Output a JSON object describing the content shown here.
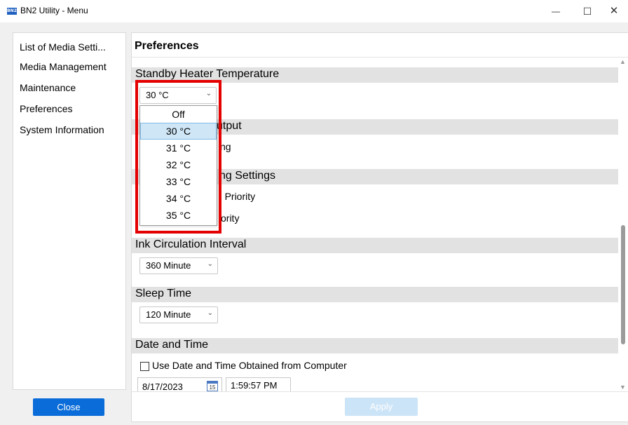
{
  "window": {
    "title": "BN2 Utility - Menu",
    "app_icon_text": "BN2",
    "minimize": "—",
    "maximize": "☐",
    "close": "✕"
  },
  "sidebar": {
    "items": [
      {
        "label": "List of Media Setti..."
      },
      {
        "label": "Media Management"
      },
      {
        "label": "Maintenance"
      },
      {
        "label": "Preferences"
      },
      {
        "label": "System Information"
      }
    ]
  },
  "close_button": "Close",
  "apply_button": "Apply",
  "main": {
    "title": "Preferences",
    "sections": {
      "standby_heater": {
        "heading": "Standby Heater Temperature",
        "selected": "30 °C"
      },
      "output": {
        "heading_fragment": "utput",
        "option_fragment": "ng"
      },
      "print_settings": {
        "heading_fragment": "ng Settings",
        "option1_fragment": "' Priority",
        "option2_fragment": "ority"
      },
      "ink_circulation": {
        "heading": "Ink Circulation Interval",
        "value": "360 Minute"
      },
      "sleep_time": {
        "heading": "Sleep Time",
        "value": "120 Minute"
      },
      "date_time": {
        "heading": "Date and Time",
        "checkbox_label": "Use Date and Time Obtained from Computer",
        "date": "8/17/2023",
        "calendar_day": "15",
        "time": "1:59:57 PM"
      }
    }
  },
  "dropdown": {
    "options": [
      "Off",
      "30 °C",
      "31 °C",
      "32 °C",
      "33 °C",
      "34 °C",
      "35 °C"
    ],
    "selected_index": 1
  },
  "colors": {
    "accent": "#0a6cd9",
    "highlight_border": "#e40000",
    "selected_option_bg": "#cfe6f7",
    "section_header_bg": "#e2e2e2"
  }
}
